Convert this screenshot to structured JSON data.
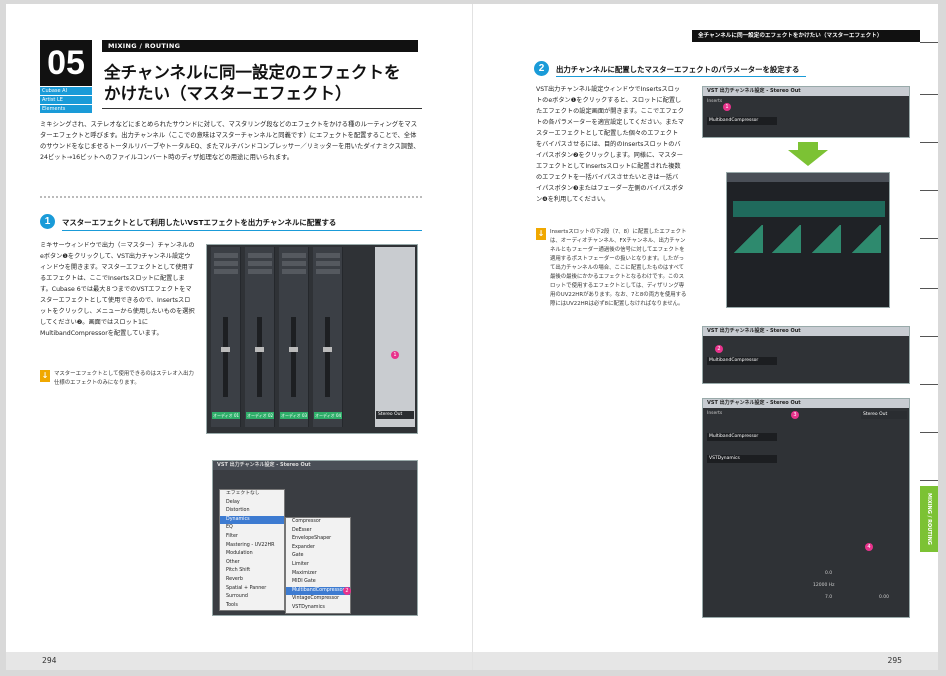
{
  "left_page": {
    "chapter_number": "05",
    "tags": [
      "Cubase AI",
      "Artist LE",
      "Elements"
    ],
    "category": "MIXING / ROUTING",
    "title_line1": "全チャンネルに同一設定のエフェクトを",
    "title_line2": "かけたい（マスターエフェクト）",
    "intro": "ミキシングされ、ステレオなどにまとめられたサウンドに対して、マスタリング段などのエフェクトをかける種のルーティングをマスターエフェクトと呼びます。出力チャンネル（ここでの意味はマスターチャンネルと同義です）にエフェクトを配置することで、全体のサウンドをなじませるトータルリバーブやトータルEQ、またマルチバンドコンプレッサー／リミッターを用いたダイナミクス調整、24ビット→16ビットへのファイルコンバート時のディザ処理などの用途に用いられます。",
    "step1_number": "1",
    "step1_title": "マスターエフェクトとして利用したいVSTエフェクトを出力チャンネルに配置する",
    "step1_body": "ミキサーウィンドウで出力（＝マスター）チャンネルのeボタン❶をクリックして、VST出力チャンネル設定ウィンドウを開きます。マスターエフェクトとして使用するエフェクトは、ここでInsertsスロットに配置します。Cubase 6では最大８つまでのVSTエフェクトをマスターエフェクトとして使用できるので、Insertsスロットをクリックし、メニューから使用したいものを選択してください❷。画面ではスロット1にMultibandCompressorを配置しています。",
    "step1_note": "マスターエフェクトとして使用できるのはステレオ入出力仕様のエフェクトのみになります。",
    "page_number": "294",
    "mixer": {
      "channel_labels": [
        "オーディオ 01",
        "オーディオ 02",
        "オーディオ 03",
        "オーディオ 04"
      ],
      "channel_numbers": [
        "1",
        "2",
        "3",
        "4"
      ],
      "stereo_out_label": "Stereo Out",
      "stereo_in_labels": [
        "Stereo In",
        "Stereo In",
        "Stereo In",
        "Stereo In"
      ]
    },
    "vst_window_title": "VST 出力チャンネル設定 - Stereo Out",
    "menu_left": [
      "エフェクトなし",
      "Delay",
      "Distortion",
      "Dynamics",
      "EQ",
      "Filter",
      "Mastering - UV22HR",
      "Modulation",
      "Other",
      "Pitch Shift",
      "Reverb",
      "Spatial + Panner",
      "Surround",
      "Tools"
    ],
    "menu_left_selected": "Dynamics",
    "menu_right": [
      "Compressor",
      "DeEsser",
      "EnvelopeShaper",
      "Expander",
      "Gate",
      "Limiter",
      "Maximizer",
      "MIDI Gate",
      "MultibandCompressor",
      "VintageCompressor",
      "VSTDynamics"
    ],
    "menu_right_selected": "MultibandCompressor"
  },
  "right_page": {
    "header": "全チャンネルに同一設定のエフェクトをかけたい（マスターエフェクト）",
    "step2_number": "2",
    "step2_title": "出力チャンネルに配置したマスターエフェクトのパラメーターを設定する",
    "step2_body": "VST出力チャンネル設定ウィンドウでInsertsスロットのeボタン❶をクリックすると、スロットに配置したエフェクトの設定画面が開きます。ここでエフェクトの各パラメーターを適宜設定してください。またマスターエフェクトとして配置した個々のエフェクトをバイパスさせるには、目的のInsertsスロットのバイパスボタン❷をクリックします。同様に、マスターエフェクトとしてInsertsスロットに配置された複数のエフェクトを一括バイパスさせたいときは一括バイパスボタン❸またはフェーダー左側のバイパスボタン❹を利用してください。",
    "step2_note": "Insertsスロットの下2段（7、8）に配置したエフェクトは、オーディオチャンネル、FXチャンネル、出力チャンネルともフェーダー通過後の信号に対してエフェクトを適用するポストフェーダーの扱いとなります。したがって出力チャンネルの場合、ここに配置したものはすべて最後の最後にかかるエフェクトとなるわけです。このスロットで使用するエフェクトとしては、ディザリング専用のUV22HRがあります。なお、7と8の両方を使用する際にはUV22HRは必ず8に配置しなければなりません。",
    "page_number": "295",
    "side_tab": "MIXING / ROUTING",
    "shot1_title": "VST 出力チャンネル設定 - Stereo Out",
    "shot1_slot": "MultibandCompressor",
    "shot1_inserts": "Inserts",
    "shot2_title": "VST 出力チャンネル設定 - Stereo Out",
    "shot2_slot": "MultibandCompressor",
    "shot3_title": "VST 出力チャンネル設定 - Stereo Out",
    "shot3_inserts": "Inserts",
    "shot3_slot1": "MultibandCompressor",
    "shot3_slot2": "VSTDynamics",
    "shot3_stereo_out": "Stereo Out",
    "shot3_values": [
      "0.0",
      "12000 Hz",
      "7.0",
      "0.00"
    ]
  },
  "colors": {
    "accent_blue": "#1a9bd8",
    "accent_green": "#7cc234",
    "marker_pink": "#e8338c",
    "note_orange": "#f0a800",
    "dark": "#111111"
  }
}
